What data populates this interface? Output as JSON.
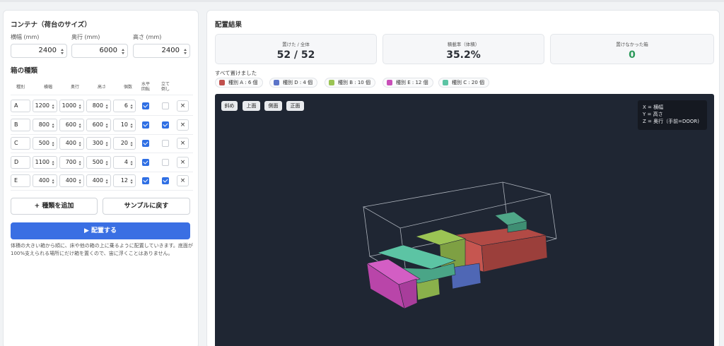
{
  "container": {
    "section_title": "コンテナ（荷台のサイズ）",
    "fields": [
      {
        "label": "横幅 (mm)",
        "value": "2400"
      },
      {
        "label": "奥行 (mm)",
        "value": "6000"
      },
      {
        "label": "高さ (mm)",
        "value": "2400"
      }
    ]
  },
  "box_types": {
    "section_title": "箱の種類",
    "headers": [
      "種別",
      "横幅",
      "奥行",
      "高さ",
      "個数",
      "水平\n回転",
      "立て\n倒し"
    ],
    "rows": [
      {
        "id": "A",
        "w": "1200",
        "d": "1000",
        "h": "800",
        "count": "6",
        "rotate": true,
        "tilt": false
      },
      {
        "id": "B",
        "w": "800",
        "d": "600",
        "h": "600",
        "count": "10",
        "rotate": true,
        "tilt": true
      },
      {
        "id": "C",
        "w": "500",
        "d": "400",
        "h": "300",
        "count": "20",
        "rotate": true,
        "tilt": false
      },
      {
        "id": "D",
        "w": "1100",
        "d": "700",
        "h": "500",
        "count": "4",
        "rotate": true,
        "tilt": false
      },
      {
        "id": "E",
        "w": "400",
        "d": "400",
        "h": "400",
        "count": "12",
        "rotate": true,
        "tilt": true
      }
    ],
    "delete_label": "×"
  },
  "buttons": {
    "add_type": "+ 種類を追加",
    "reset_sample": "サンプルに戻す",
    "place": "▶ 配置する"
  },
  "description": "体積の大きい箱から順に、床や他の箱の上に乗るように配置していきます。底面が100%支えられる場所にだけ箱を置くので、宙に浮くことはありません。",
  "result": {
    "title": "配置結果",
    "stats": [
      {
        "label": "置けた / 全体",
        "value": "52 / 52"
      },
      {
        "label": "積載率（体積）",
        "value": "35.2%"
      },
      {
        "label": "置けなかった箱",
        "value": "0"
      }
    ],
    "all_placed": "すべて置けました",
    "type_pills": [
      {
        "label": "種別 A : 6 個",
        "color": "#c0504d"
      },
      {
        "label": "種別 D : 4 個",
        "color": "#5b74c8"
      },
      {
        "label": "種別 B : 10 個",
        "color": "#9bc454"
      },
      {
        "label": "種別 E : 12 個",
        "color": "#c94fb8"
      },
      {
        "label": "種別 C : 20 個",
        "color": "#5cc4a4"
      }
    ]
  },
  "viewer": {
    "view_buttons": [
      "斜め",
      "上面",
      "側面",
      "正面"
    ],
    "axis_legend": [
      "X = 横幅",
      "Y = 高さ",
      "Z = 奥行（手前=DOOR)"
    ]
  },
  "colors": {
    "accent": "#3a6fe3",
    "success": "#2d9a5b",
    "viewer_bg": "#1f2633"
  }
}
